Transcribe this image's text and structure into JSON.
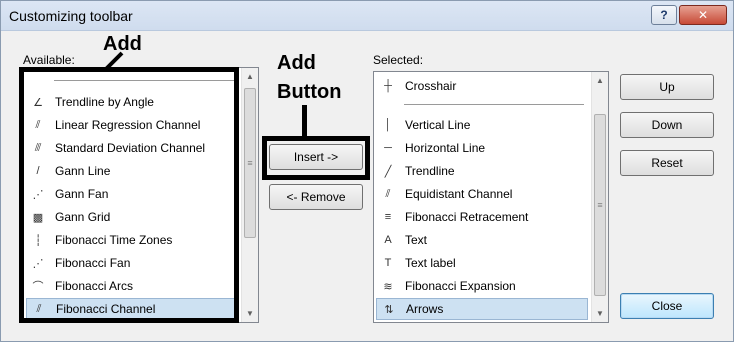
{
  "window": {
    "title": "Customizing toolbar",
    "help_label": "?",
    "close_label": "✕"
  },
  "available": {
    "label": "Available:",
    "items": [
      {
        "label": "Trendline by Angle",
        "icon": "trendline-by-angle-icon",
        "glyph": "∠"
      },
      {
        "label": "Linear Regression Channel",
        "icon": "linear-regression-channel-icon",
        "glyph": "⫽"
      },
      {
        "label": "Standard Deviation Channel",
        "icon": "standard-deviation-channel-icon",
        "glyph": "⫻"
      },
      {
        "label": "Gann Line",
        "icon": "gann-line-icon",
        "glyph": "/"
      },
      {
        "label": "Gann Fan",
        "icon": "gann-fan-icon",
        "glyph": "⋰"
      },
      {
        "label": "Gann Grid",
        "icon": "gann-grid-icon",
        "glyph": "▩"
      },
      {
        "label": "Fibonacci Time Zones",
        "icon": "fibonacci-time-zones-icon",
        "glyph": "┆"
      },
      {
        "label": "Fibonacci Fan",
        "icon": "fibonacci-fan-icon",
        "glyph": "⋰"
      },
      {
        "label": "Fibonacci Arcs",
        "icon": "fibonacci-arcs-icon",
        "glyph": "⌒"
      },
      {
        "label": "Fibonacci Channel",
        "icon": "fibonacci-channel-icon",
        "glyph": "⫽"
      }
    ]
  },
  "selected": {
    "label": "Selected:",
    "items": [
      {
        "label": "Crosshair",
        "icon": "crosshair-icon",
        "glyph": "┼"
      },
      {
        "label": "Vertical Line",
        "icon": "vertical-line-icon",
        "glyph": "│"
      },
      {
        "label": "Horizontal Line",
        "icon": "horizontal-line-icon",
        "glyph": "─"
      },
      {
        "label": "Trendline",
        "icon": "trendline-icon",
        "glyph": "╱"
      },
      {
        "label": "Equidistant Channel",
        "icon": "equidistant-channel-icon",
        "glyph": "⫽"
      },
      {
        "label": "Fibonacci Retracement",
        "icon": "fibonacci-retracement-icon",
        "glyph": "≡"
      },
      {
        "label": "Text",
        "icon": "text-icon",
        "glyph": "A"
      },
      {
        "label": "Text label",
        "icon": "text-label-icon",
        "glyph": "T"
      },
      {
        "label": "Fibonacci Expansion",
        "icon": "fibonacci-expansion-icon",
        "glyph": "≋"
      },
      {
        "label": "Arrows",
        "icon": "arrows-icon",
        "glyph": "⇅"
      }
    ]
  },
  "buttons": {
    "insert": "Insert ->",
    "remove": "<- Remove",
    "up": "Up",
    "down": "Down",
    "reset": "Reset",
    "close": "Close"
  },
  "annotations": {
    "add": "Add",
    "add_button_line1": "Add",
    "add_button_line2": "Button"
  },
  "colors": {
    "selection": "#cde1f2",
    "annotation": "#000000",
    "close_button": "#c74a37"
  }
}
